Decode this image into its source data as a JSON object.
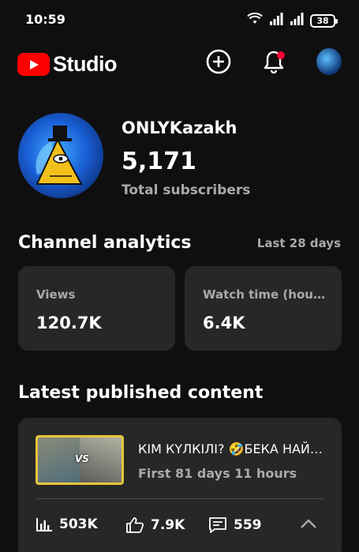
{
  "status_bar": {
    "time": "10:59",
    "battery": "38",
    "icons": [
      "wifi-icon",
      "signal-icon",
      "signal-icon",
      "battery-icon"
    ]
  },
  "app_bar": {
    "logo_text": "Studio",
    "actions": [
      "create-icon",
      "notifications-icon",
      "account-avatar"
    ],
    "brand_color": "#ff0000"
  },
  "channel": {
    "name": "ONLYKazakh",
    "subscribers": "5,171",
    "subscribers_label": "Total subscribers"
  },
  "analytics": {
    "title": "Channel analytics",
    "period": "Last 28 days",
    "metrics": [
      {
        "label": "Views",
        "value": "120.7K"
      },
      {
        "label": "Watch time (hours)",
        "value": "6.4K"
      }
    ]
  },
  "latest": {
    "title": "Latest published content",
    "video": {
      "title": "КІМ КҮЛКІЛІ? 🤣БЕКА НАЙЗА",
      "meta": "First 81 days 11 hours",
      "views": "503K",
      "likes": "7.9K",
      "comments": "559"
    }
  },
  "colors": {
    "background": "#0f0f0f",
    "card": "#272727",
    "secondary_text": "#aaaaaa",
    "notification_dot": "#ff0033"
  }
}
